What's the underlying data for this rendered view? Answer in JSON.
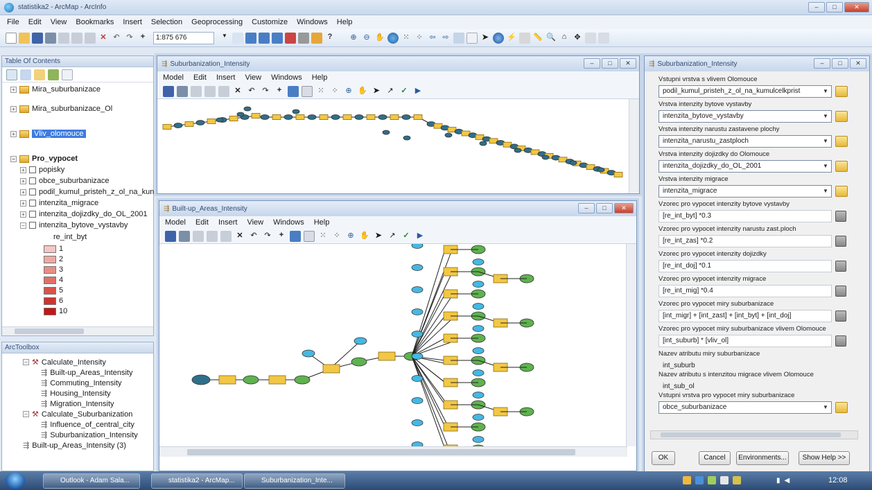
{
  "app": {
    "title": "statistika2 - ArcMap - ArcInfo"
  },
  "menu": [
    "File",
    "Edit",
    "View",
    "Bookmarks",
    "Insert",
    "Selection",
    "Geoprocessing",
    "Customize",
    "Windows",
    "Help"
  ],
  "toolbar": {
    "scale": "1:875 676"
  },
  "toc": {
    "title": "Table Of Contents",
    "groups": [
      "Mira_suburbanizace",
      "Mira_suburbanizace_Ol",
      "Vliv_olomouce",
      "Pro_vypocet"
    ],
    "layers": [
      "popisky",
      "obce_suburbanizace",
      "podil_kumul_pristeh_z_ol_na_kun",
      "intenzita_migrace",
      "intenzita_dojizdky_do_OL_2001",
      "intenzita_bytove_vystavby"
    ],
    "field": "re_int_byt",
    "legend": [
      {
        "label": "1",
        "color": "#f3c7c4"
      },
      {
        "label": "2",
        "color": "#eeaaa5"
      },
      {
        "label": "3",
        "color": "#e88e86"
      },
      {
        "label": "4",
        "color": "#e07168"
      },
      {
        "label": "5",
        "color": "#d8534b"
      },
      {
        "label": "6",
        "color": "#cf342e"
      },
      {
        "label": "10",
        "color": "#c41614"
      }
    ]
  },
  "toolbox": {
    "title": "ArcToolbox",
    "items": [
      {
        "label": "Calculate_Intensity",
        "level": 1,
        "type": "toolset"
      },
      {
        "label": "Built-up_Areas_Intensity",
        "level": 2,
        "type": "model"
      },
      {
        "label": "Commuting_Intensity",
        "level": 2,
        "type": "model"
      },
      {
        "label": "Housing_Intensity",
        "level": 2,
        "type": "model"
      },
      {
        "label": "Migration_Intensity",
        "level": 2,
        "type": "model"
      },
      {
        "label": "Calculate_Suburbanization",
        "level": 1,
        "type": "toolset"
      },
      {
        "label": "Influence_of_central_city",
        "level": 2,
        "type": "model"
      },
      {
        "label": "Suburbanization_Intensity",
        "level": 2,
        "type": "model"
      },
      {
        "label": "Built-up_Areas_Intensity (3)",
        "level": 0,
        "type": "model"
      }
    ]
  },
  "win1": {
    "title": "Suburbanization_Intensity",
    "menu": [
      "Model",
      "Edit",
      "Insert",
      "View",
      "Windows",
      "Help"
    ]
  },
  "win2": {
    "title": "Built-up_Areas_Intensity",
    "menu": [
      "Model",
      "Edit",
      "Insert",
      "View",
      "Windows",
      "Help"
    ]
  },
  "dialog": {
    "title": "Suburbanization_Intensity",
    "fields": [
      {
        "label": "Vstupni vrstva s vlivem Olomouce",
        "value": "podil_kumul_pristeh_z_ol_na_kumulcelkprist",
        "kind": "select"
      },
      {
        "label": "Vrstva intenzity bytove vystavby",
        "value": "intenzita_bytove_vystavby",
        "kind": "select"
      },
      {
        "label": "Vrstva intenzity narustu zastavene plochy",
        "value": "intenzita_narustu_zastploch",
        "kind": "select"
      },
      {
        "label": "Vrstva intenzity dojizdky do Olomouce",
        "value": "intenzita_dojizdky_do_OL_2001",
        "kind": "select"
      },
      {
        "label": "Vrstva intenzity migrace",
        "value": "intenzita_migrace",
        "kind": "select"
      },
      {
        "label": "Vzorec pro vypocet intenzity bytove vystavby",
        "value": "[re_int_byt] *0.3",
        "kind": "calc"
      },
      {
        "label": "Vzorec pro vypocet intenzity narustu zast.ploch",
        "value": "[re_int_zas] *0.2",
        "kind": "calc"
      },
      {
        "label": "Vzorec pro vypocet intenzity dojizdky",
        "value": "[re_int_doj] *0.1",
        "kind": "calc"
      },
      {
        "label": "Vzorec pro vypocet intenzity migrace",
        "value": "[re_int_mig] *0.4",
        "kind": "calc"
      },
      {
        "label": "Vzorec pro vypocet miry suburbanizace",
        "value": "[int_migr] + [int_zast] + [int_byt] + [int_doj]",
        "kind": "calc"
      },
      {
        "label": "Vzorec pro vypocet miry suburbanizace vlivem Olomouce",
        "value": "[int_suburb] * [vliv_ol]",
        "kind": "calc"
      },
      {
        "label": "Nazev atributu miry suburbanizace",
        "value": "int_suburb",
        "kind": "plain"
      },
      {
        "label": "Nazev atributu s intenzitou migrace vlivem Olomouce",
        "value": "int_sub_ol",
        "kind": "plain"
      },
      {
        "label": "Vstupni vrstva pro vypocet miry suburbanizace",
        "value": "obce_suburbanizace",
        "kind": "select"
      }
    ],
    "buttons": {
      "ok": "OK",
      "cancel": "Cancel",
      "env": "Environments...",
      "help": "Show Help >>"
    }
  },
  "taskbar": {
    "items": [
      "Outlook - Adam Sala...",
      "statistika2 - ArcMap...",
      "Suburbanization_Inte..."
    ],
    "time": "12:08"
  },
  "colors": {
    "data": "#2f6f8a",
    "process": "#f2c744",
    "output": "#5fb24f",
    "input": "#45b8e3"
  }
}
